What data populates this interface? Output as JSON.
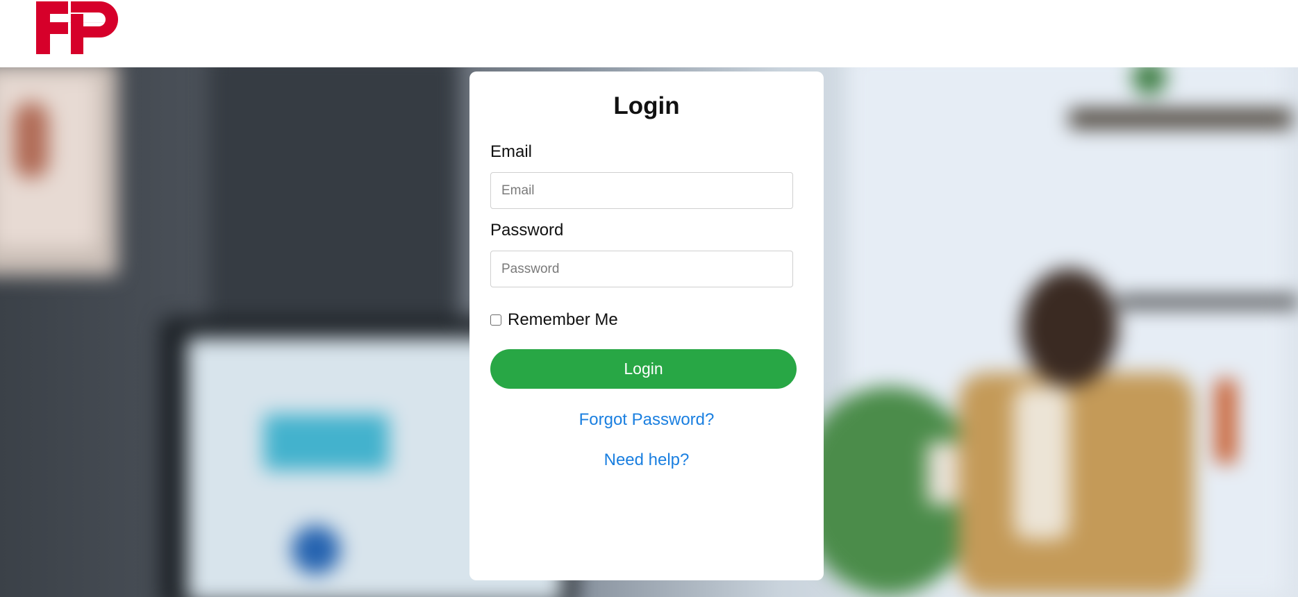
{
  "brand": {
    "logo_name": "FP",
    "logo_color": "#d6002a"
  },
  "login": {
    "title": "Login",
    "email_label": "Email",
    "email_placeholder": "Email",
    "email_value": "",
    "password_label": "Password",
    "password_placeholder": "Password",
    "password_value": "",
    "remember_label": "Remember Me",
    "remember_checked": false,
    "submit_label": "Login",
    "forgot_link": "Forgot Password?",
    "help_link": "Need help?"
  },
  "colors": {
    "primary_button": "#28a745",
    "link": "#1a7fe0"
  }
}
